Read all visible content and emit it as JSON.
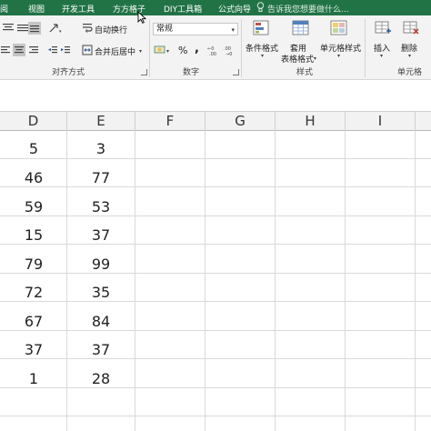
{
  "tabs": [
    "阅",
    "视图",
    "开发工具",
    "方方格子",
    "DIY工具箱",
    "公式向导"
  ],
  "tell_me": "告诉我您想要做什么...",
  "alignment": {
    "wrap_text": "自动换行",
    "merge_center": "合并后居中",
    "group_label": "对齐方式"
  },
  "number": {
    "format_value": "常规",
    "percent": "%",
    "comma": ",",
    "group_label": "数字"
  },
  "styles": {
    "conditional_format": "条件格式",
    "table_format_line1": "套用",
    "table_format_line2": "表格格式",
    "cell_styles": "单元格样式",
    "group_label": "样式"
  },
  "cells": {
    "insert": "插入",
    "delete": "删除",
    "group_label": "单元格"
  },
  "columns": [
    "D",
    "E",
    "F",
    "G",
    "H",
    "I"
  ],
  "rows": [
    {
      "d": "5",
      "e": "3"
    },
    {
      "d": "46",
      "e": "77"
    },
    {
      "d": "59",
      "e": "53"
    },
    {
      "d": "15",
      "e": "37"
    },
    {
      "d": "79",
      "e": "99"
    },
    {
      "d": "72",
      "e": "35"
    },
    {
      "d": "67",
      "e": "84"
    },
    {
      "d": "37",
      "e": "37"
    },
    {
      "d": "1",
      "e": "28"
    }
  ],
  "colors": {
    "ribbon_tab_bar": "#217346",
    "ribbon_body": "#f3f3f3",
    "header_bg": "#f2f2f2",
    "gridline": "#dadada"
  }
}
